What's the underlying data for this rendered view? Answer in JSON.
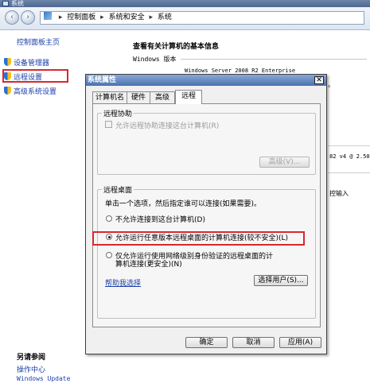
{
  "window": {
    "title": "系统"
  },
  "breadcrumb": [
    "控制面板",
    "系统和安全",
    "系统"
  ],
  "left_nav": {
    "home": "控制面板主页",
    "items": [
      "设备管理器",
      "远程设置",
      "高级系统设置"
    ],
    "see_also_title": "另请参阅",
    "see_also": [
      "操作中心",
      "Windows Update"
    ]
  },
  "main": {
    "heading": "查看有关计算机的基本信息",
    "edition_label": "Windows 版本",
    "edition_value": "Windows Server 2008 R2 Enterprise",
    "cpu_fragment": "82 v4 @ 2.50",
    "pen_fragment": "控输入",
    "dot_fragment": "。"
  },
  "dialog": {
    "title": "系统属性",
    "close_glyph": "✕",
    "tabs": [
      "计算机名",
      "硬件",
      "高级",
      "远程"
    ],
    "active_tab": 3,
    "remote_assistance": {
      "title": "远程协助",
      "checkbox_label": "允许远程协助连接这台计算机(R)",
      "advanced_button": "高级(V)..."
    },
    "remote_desktop": {
      "title": "远程桌面",
      "instruction": "单击一个选项，然后指定谁可以连接(如果需要)。",
      "options": [
        "不允许连接到这台计算机(D)",
        "允许运行任意版本远程桌面的计算机连接(较不安全)(L)",
        "仅允许运行使用网络级别身份验证的远程桌面的计",
        "算机连接(更安全)(N)"
      ],
      "selected": 1,
      "help_link": "帮助我选择",
      "select_users_button": "选择用户(S)..."
    },
    "buttons": {
      "ok": "确定",
      "cancel": "取消",
      "apply": "应用(A)"
    }
  },
  "colors": {
    "highlight_border": "#d8282e",
    "link": "#1a3ea8"
  }
}
